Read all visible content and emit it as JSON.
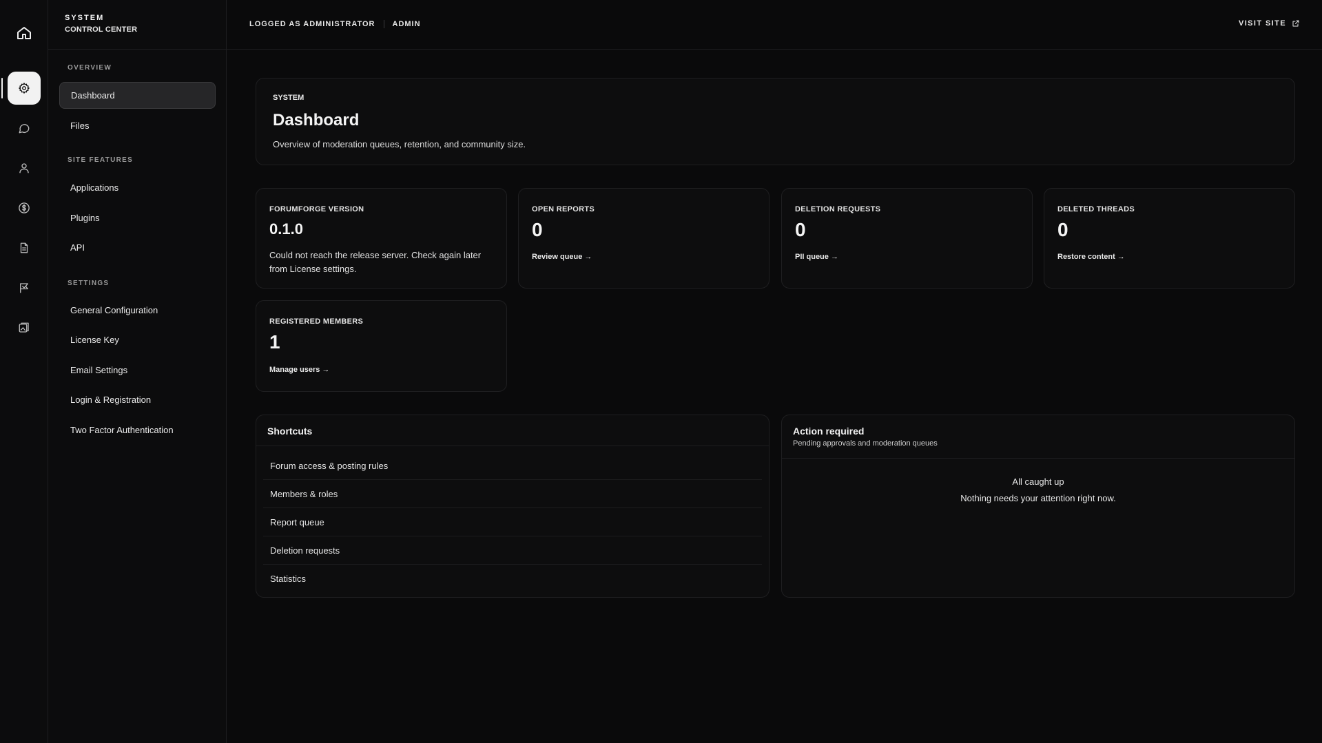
{
  "brand": {
    "top": "SYSTEM",
    "bottom": "CONTROL CENTER"
  },
  "rail": {
    "icons": [
      "home-icon",
      "gear-icon",
      "chat-bubble-icon",
      "user-icon",
      "dollar-icon",
      "document-icon",
      "flag-icon",
      "gallery-icon"
    ],
    "active": "gear-icon"
  },
  "sidebar": {
    "sections": [
      {
        "label": "OVERVIEW",
        "items": [
          {
            "label": "Dashboard",
            "active": true
          },
          {
            "label": "Files"
          }
        ]
      },
      {
        "label": "SITE FEATURES",
        "items": [
          {
            "label": "Applications"
          },
          {
            "label": "Plugins"
          },
          {
            "label": "API"
          }
        ]
      },
      {
        "label": "SETTINGS",
        "items": [
          {
            "label": "General Configuration"
          },
          {
            "label": "License Key"
          },
          {
            "label": "Email Settings"
          },
          {
            "label": "Login & Registration"
          },
          {
            "label": "Two Factor Authentication"
          }
        ]
      }
    ]
  },
  "topbar": {
    "logged_as": "LOGGED AS ADMINISTRATOR",
    "username": "ADMIN",
    "visit_site": "VISIT SITE"
  },
  "hero": {
    "kicker": "SYSTEM",
    "title": "Dashboard",
    "description": "Overview of moderation queues, retention, and community size."
  },
  "stats": [
    {
      "label": "FORUMFORGE VERSION",
      "value": "0.1.0",
      "note": "Could not reach the release server. Check again later from License settings."
    },
    {
      "label": "OPEN REPORTS",
      "value": "0",
      "link": "Review queue →"
    },
    {
      "label": "DELETION REQUESTS",
      "value": "0",
      "link": "PII queue →"
    },
    {
      "label": "DELETED THREADS",
      "value": "0",
      "link": "Restore content →"
    },
    {
      "label": "REGISTERED MEMBERS",
      "value": "1",
      "link": "Manage users →"
    }
  ],
  "shortcuts": {
    "title": "Shortcuts",
    "items": [
      "Forum access & posting rules",
      "Members & roles",
      "Report queue",
      "Deletion requests",
      "Statistics"
    ]
  },
  "action_required": {
    "title": "Action required",
    "subtitle": "Pending approvals and moderation queues",
    "empty_title": "All caught up",
    "empty_subtitle": "Nothing needs your attention right now."
  },
  "colors": {
    "background": "#0a0a0b",
    "card": "#0d0d0e",
    "active_nav": "#262628",
    "active_rail": "#f2f2f2"
  }
}
